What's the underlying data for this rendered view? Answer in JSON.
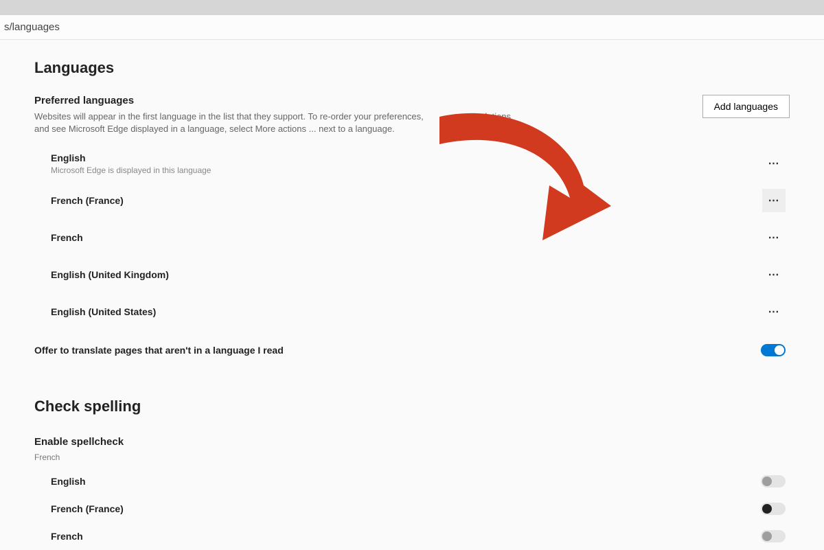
{
  "url_fragment": "s/languages",
  "sections": {
    "languages": {
      "title": "Languages",
      "preferred_title": "Preferred languages",
      "preferred_desc_a": "Websites will appear in the first language in the list that they support. To re-order your preferences, ",
      "preferred_desc_b": "translations and see Microsoft Edge displayed in a language, select More actions ... next to a language.",
      "add_button": "Add languages",
      "items": [
        {
          "label": "English",
          "sub": "Microsoft Edge is displayed in this language",
          "highlight": false
        },
        {
          "label": "French (France)",
          "sub": "",
          "highlight": true
        },
        {
          "label": "French",
          "sub": "",
          "highlight": false
        },
        {
          "label": "English (United Kingdom)",
          "sub": "",
          "highlight": false
        },
        {
          "label": "English (United States)",
          "sub": "",
          "highlight": false
        }
      ],
      "translate_option": "Offer to translate pages that aren't in a language I read",
      "translate_on": true
    },
    "spelling": {
      "title": "Check spelling",
      "enable_title": "Enable spellcheck",
      "enable_sub": "French",
      "items": [
        {
          "label": "English",
          "state": "off"
        },
        {
          "label": "French (France)",
          "state": "on-dark"
        },
        {
          "label": "French",
          "state": "off"
        }
      ]
    }
  },
  "more_glyph": "⋯"
}
